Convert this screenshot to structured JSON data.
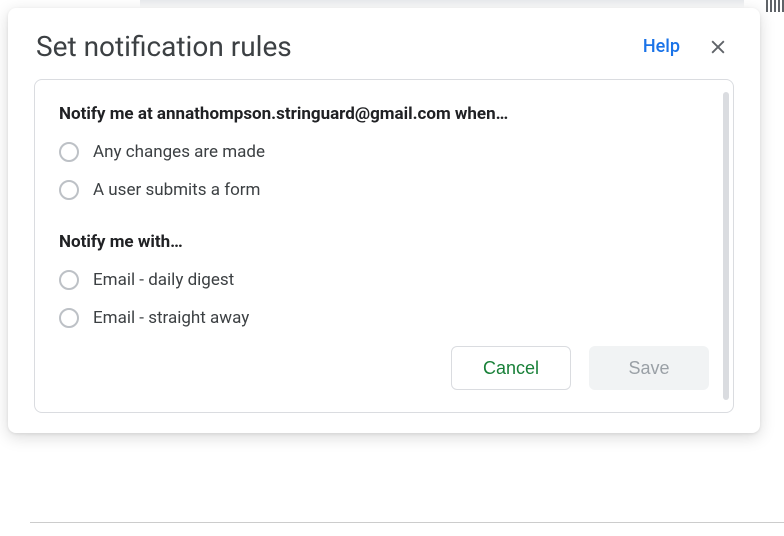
{
  "dialog": {
    "title": "Set notification rules",
    "help_label": "Help",
    "section1_heading": "Notify me at annathompson.stringuard@gmail.com when…",
    "option_any_changes": "Any changes are made",
    "option_form_submit": "A user submits a form",
    "section2_heading": "Notify me with…",
    "option_daily_digest": "Email - daily digest",
    "option_straight_away": "Email - straight away",
    "cancel_label": "Cancel",
    "save_label": "Save"
  }
}
